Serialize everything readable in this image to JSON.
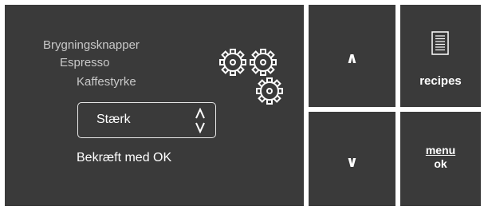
{
  "breadcrumb": {
    "level1": "Brygningsknapper",
    "level2": "Espresso",
    "level3": "Kaffestyrke"
  },
  "selector": {
    "value": "Stærk"
  },
  "confirm_text": "Bekræft med OK",
  "buttons": {
    "up_symbol": "∧",
    "down_symbol": "∨",
    "recipes_label": "recipes",
    "menu_label": "menu",
    "ok_label": "ok"
  },
  "icons": {
    "settings": "gears-icon",
    "stepper": "up-down-chevron-icon",
    "recipes": "document-icon"
  },
  "colors": {
    "panel": "#3a3a3a",
    "text_primary": "#ffffff",
    "text_secondary": "#c9c9c9",
    "background": "#ffffff"
  }
}
